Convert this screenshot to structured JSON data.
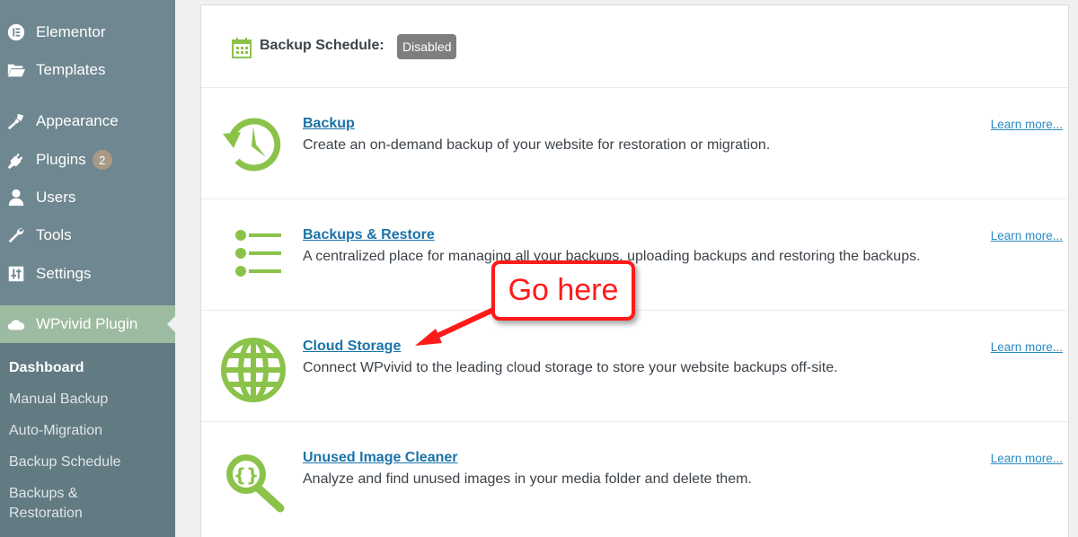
{
  "sidebar": {
    "items": [
      {
        "label": "Elementor",
        "icon": "elementor-icon"
      },
      {
        "label": "Templates",
        "icon": "folder-icon"
      },
      {
        "label": "Appearance",
        "icon": "paintbrush-icon"
      },
      {
        "label": "Plugins",
        "icon": "plug-icon",
        "badge": "2"
      },
      {
        "label": "Users",
        "icon": "user-icon"
      },
      {
        "label": "Tools",
        "icon": "wrench-icon"
      },
      {
        "label": "Settings",
        "icon": "sliders-icon"
      },
      {
        "label": "WPvivid Plugin",
        "icon": "cloud-icon",
        "active": true
      }
    ],
    "submenu": [
      {
        "label": "Dashboard",
        "current": true
      },
      {
        "label": "Manual Backup"
      },
      {
        "label": "Auto-Migration"
      },
      {
        "label": "Backup Schedule"
      },
      {
        "label": "Backups &\nRestoration"
      }
    ]
  },
  "schedule": {
    "label": "Backup Schedule:",
    "status": "Disabled",
    "icon": "calendar-icon"
  },
  "features": [
    {
      "title": "Backup",
      "description": "Create an on-demand backup of your website for restoration or migration.",
      "learn_more": "Learn more...",
      "icon": "backup-clock-icon"
    },
    {
      "title": "Backups & Restore",
      "description": "A centralized place for managing all your backups, uploading backups and restoring the backups.",
      "learn_more": "Learn more...",
      "icon": "list-icon"
    },
    {
      "title": "Cloud Storage",
      "description": "Connect WPvivid to the leading cloud storage to store your website backups off-site.",
      "learn_more": "Learn more...",
      "icon": "globe-icon"
    },
    {
      "title": "Unused Image Cleaner",
      "description": "Analyze and find unused images in your media folder and delete them.",
      "learn_more": "Learn more...",
      "icon": "magnifier-icon"
    }
  ],
  "annotation": {
    "text": "Go here",
    "color": "#ff1a1a"
  },
  "colors": {
    "sidebar_bg": "#6f8790",
    "active_bg": "#9dbba0",
    "icon_green": "#8bc34a",
    "link_blue": "#1a73a8"
  }
}
